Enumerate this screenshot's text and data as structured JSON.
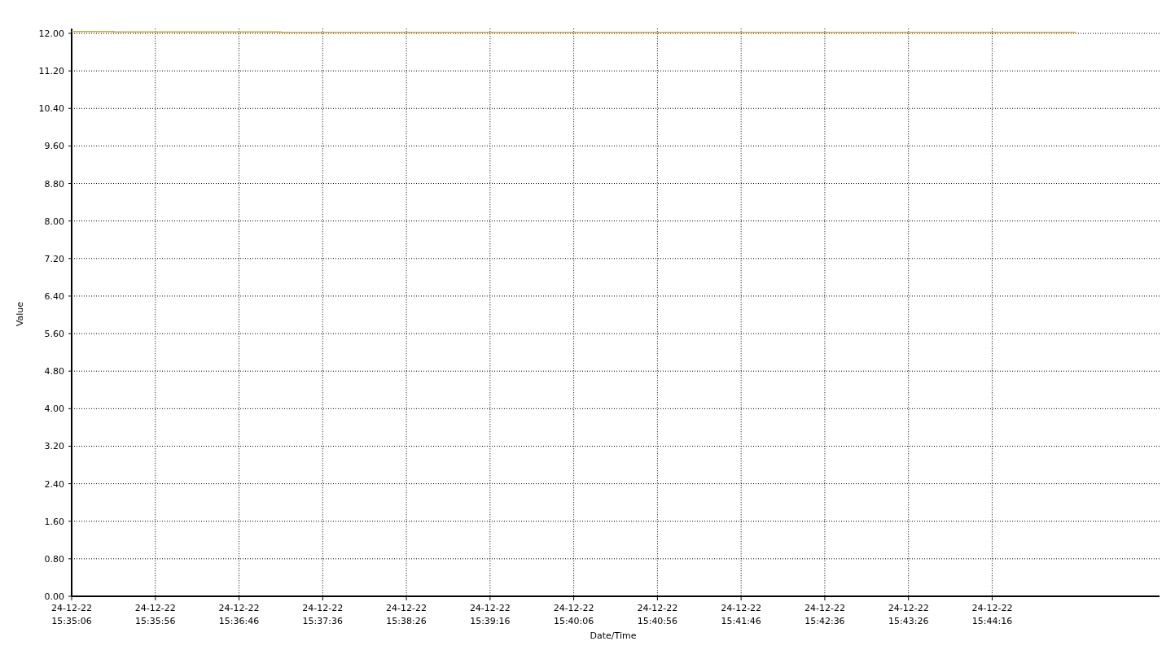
{
  "chart": {
    "chart_data": {
      "type": "line",
      "xlabel": "Date/Time",
      "ylabel": "Value",
      "categories": [
        "24-12-22 15:35:06",
        "24-12-22 15:35:56",
        "24-12-22 15:36:46",
        "24-12-22 15:37:36",
        "24-12-22 15:38:26",
        "24-12-22 15:39:16",
        "24-12-22 15:40:06",
        "24-12-22 15:40:56",
        "24-12-22 15:41:46",
        "24-12-22 15:42:36",
        "24-12-22 15:43:26",
        "24-12-22 15:44:16",
        null,
        null
      ],
      "series": [
        {
          "color": "#d4a73c",
          "values": [
            12.04,
            12.03,
            12.03,
            12.02,
            12.02,
            12.02,
            12.02,
            12.02,
            12.02,
            12.02,
            12.02,
            12.02,
            12.02,
            null
          ]
        }
      ],
      "ylim": [
        0,
        12.1
      ],
      "grid": true,
      "yticks": [
        {
          "value": 0,
          "label": "0.00"
        },
        {
          "value": 0.8,
          "label": "0.80"
        },
        {
          "value": 1.6,
          "label": "1.60"
        },
        {
          "value": 2.4,
          "label": "2.40"
        },
        {
          "value": 3.2,
          "label": "3.20"
        },
        {
          "value": 4,
          "label": "4.00"
        },
        {
          "value": 4.8,
          "label": "4.80"
        },
        {
          "value": 5.6,
          "label": "5.60"
        },
        {
          "value": 6.4,
          "label": "6.40"
        },
        {
          "value": 7.2,
          "label": "7.20"
        },
        {
          "value": 8,
          "label": "8.00"
        },
        {
          "value": 8.8,
          "label": "8.80"
        },
        {
          "value": 9.6,
          "label": "9.60"
        },
        {
          "value": 10.4,
          "label": "10.40"
        },
        {
          "value": 11.2,
          "label": "11.20"
        },
        {
          "value": 12,
          "label": "12.00"
        }
      ]
    }
  }
}
